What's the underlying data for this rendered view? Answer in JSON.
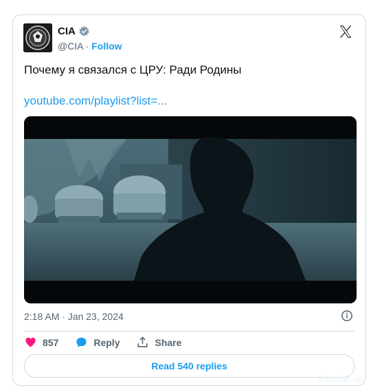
{
  "author": {
    "name": "CIA",
    "handle": "@CIA",
    "separator": " · ",
    "follow_label": "Follow"
  },
  "tweet": {
    "text": "Почему я связался с ЦРУ: Ради Родины",
    "link": "youtube.com/playlist?list=..."
  },
  "timestamp": "2:18 AM · Jan 23, 2024",
  "actions": {
    "likes": "857",
    "reply_label": "Reply",
    "share_label": "Share"
  },
  "replies_button": "Read 540 replies",
  "watermark": "Vivchan.cn",
  "colors": {
    "accent": "#1d9bf0",
    "like": "#f91880",
    "border": "#cfd9de",
    "muted": "#536471"
  },
  "icons": [
    "cia-seal-icon",
    "verified-badge-icon",
    "x-logo-icon",
    "info-icon",
    "heart-icon",
    "reply-bubble-icon",
    "share-icon"
  ]
}
